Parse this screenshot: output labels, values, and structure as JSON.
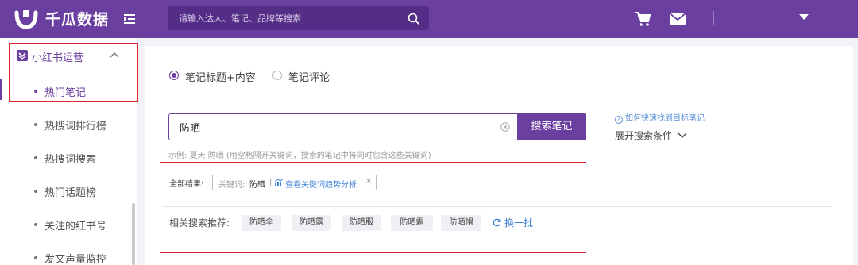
{
  "header": {
    "brand": "千瓜数据",
    "search_placeholder": "请输入达人、笔记、品牌等搜索"
  },
  "sidebar": {
    "section": {
      "label": "小红书运营",
      "icon": "xiaohongshu-icon",
      "expanded": true
    },
    "items": [
      {
        "label": "热门笔记",
        "active": true
      },
      {
        "label": "热搜词排行榜",
        "active": false
      },
      {
        "label": "热搜词搜索",
        "active": false
      },
      {
        "label": "热门话题榜",
        "active": false
      },
      {
        "label": "关注的红书号",
        "active": false
      },
      {
        "label": "发文声量监控",
        "active": false
      }
    ]
  },
  "search_panel": {
    "mode_options": [
      {
        "label": "笔记标题+内容",
        "selected": true
      },
      {
        "label": "笔记评论",
        "selected": false
      }
    ],
    "keyword_value": "防晒",
    "search_button": "搜索笔记",
    "example_text": "示例: 夏天 防晒 (用空格隔开关键词，搜索的笔记中将同时包含这些关键词)",
    "help_link": "如何快速找到目标笔记",
    "expand_filters": "展开搜索条件"
  },
  "results": {
    "label": "全部结果:",
    "tag_prefix": "关键词:",
    "tag_keyword": "防晒",
    "tag_separator": "|",
    "tag_link": "查看关键词趋势分析",
    "tag_close": "×"
  },
  "related": {
    "label": "相关搜索推荐:",
    "chips": [
      "防晒伞",
      "防晒露",
      "防晒服",
      "防晒霜",
      "防晒帽"
    ],
    "refresh": "换一批"
  },
  "colors": {
    "brand_purple": "#6b3fa0",
    "annotation_red": "#e0262a",
    "link_blue": "#3d7fd6"
  }
}
